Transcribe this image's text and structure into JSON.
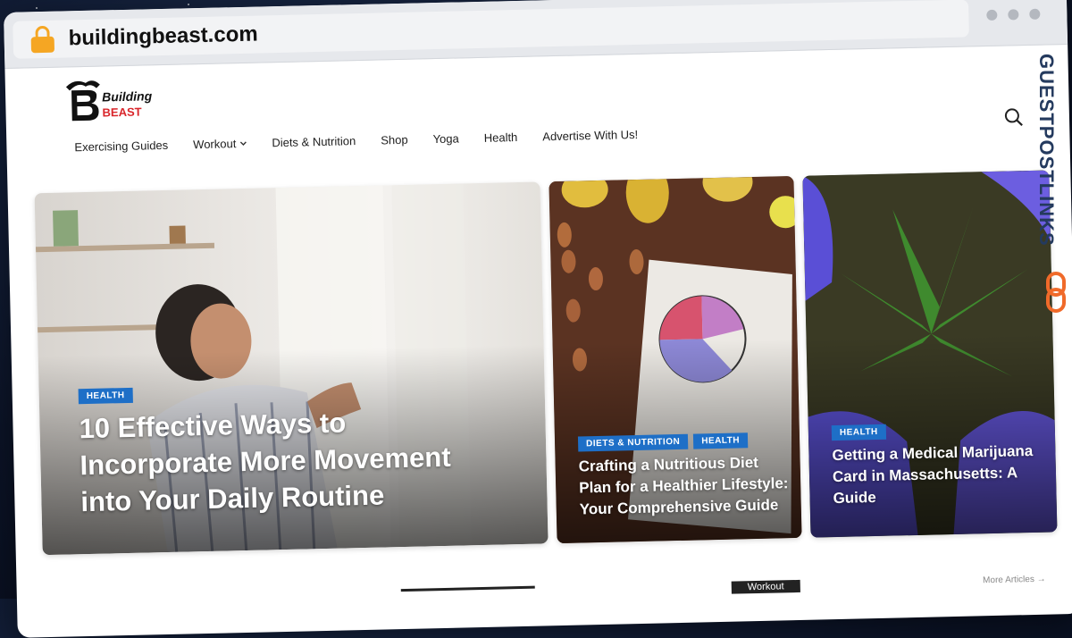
{
  "browser": {
    "url": "buildingbeast.com"
  },
  "site": {
    "logo_text_top": "Building",
    "logo_text_bottom": "BEAST",
    "nav": [
      {
        "label": "Exercising Guides"
      },
      {
        "label": "Workout"
      },
      {
        "label": "Diets & Nutrition"
      },
      {
        "label": "Shop"
      },
      {
        "label": "Yoga"
      },
      {
        "label": "Health"
      },
      {
        "label": "Advertise With Us!"
      }
    ],
    "cards": [
      {
        "tags": [
          "HEALTH"
        ],
        "title": "10 Effective Ways to Incorporate More Movement into Your Daily Routine"
      },
      {
        "tags": [
          "DIETS & NUTRITION",
          "HEALTH"
        ],
        "title": "Crafting a Nutritious Diet Plan for a Healthier Lifestyle: Your Comprehensive Guide"
      },
      {
        "tags": [
          "HEALTH"
        ],
        "title": "Getting a Medical Marijuana Card in Massachusetts: A Guide"
      }
    ],
    "strip_tab": "Workout",
    "more_articles": "More Articles →"
  },
  "watermark": {
    "text": "GUESTPOSTLINKS"
  },
  "colors": {
    "tag_blue": "#1e6fc7",
    "lock_orange": "#f5a623",
    "watermark_navy": "#243a5e",
    "watermark_orange": "#f06a2a"
  }
}
